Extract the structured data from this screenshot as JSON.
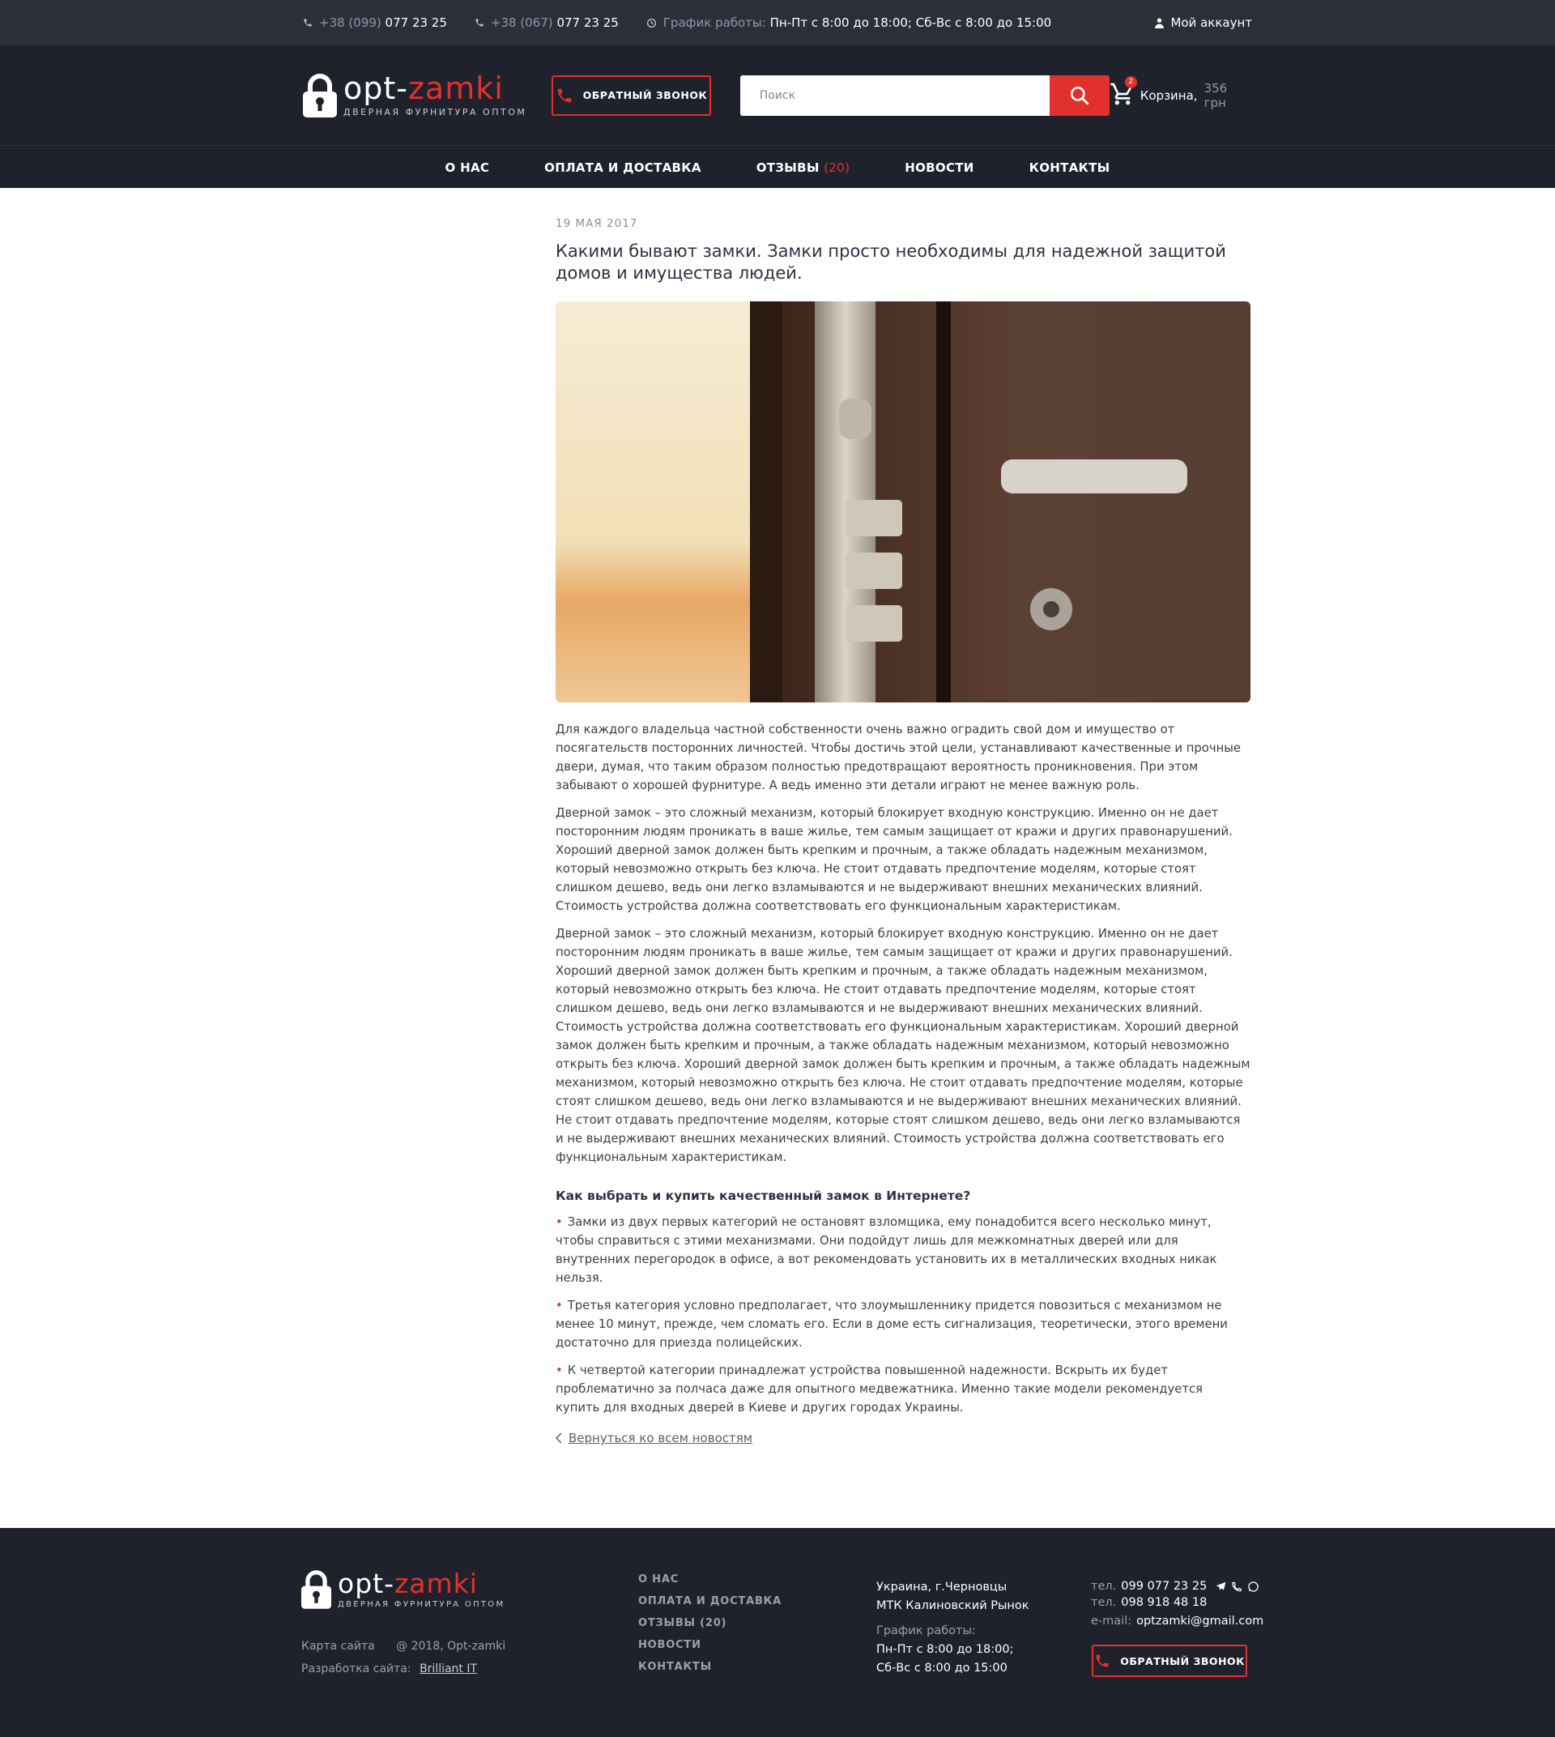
{
  "topbar": {
    "phone1_prefix": "+38 (099)",
    "phone1_number": "077 23 25",
    "phone2_prefix": "+38 (067)",
    "phone2_number": "077 23 25",
    "schedule_label": "График работы:",
    "schedule_value": "Пн-Пт с 8:00 до 18:00; Сб-Вс с  8:00 до 15:00",
    "account_label": "Мой аккаунт"
  },
  "header": {
    "logo_part1": "opt-",
    "logo_part2": "zamki",
    "logo_subtitle": "ДВЕРНАЯ ФУРНИТУРА ОПТОМ",
    "callback_label": "ОБРАТНЫЙ ЗВОНОК",
    "search_placeholder": "Поиск",
    "cart_count": "2",
    "cart_label": "Корзина,",
    "cart_sum": "356 грн"
  },
  "nav": {
    "items": [
      {
        "label": "О НАС",
        "count": ""
      },
      {
        "label": "ОПЛАТА И ДОСТАВКА",
        "count": ""
      },
      {
        "label": "ОТЗЫВЫ",
        "count": "(20)"
      },
      {
        "label": "НОВОСТИ",
        "count": ""
      },
      {
        "label": "КОНТАКТЫ",
        "count": ""
      }
    ]
  },
  "article": {
    "date": "19 МАЯ 2017",
    "title": "Какими бывают замки. Замки просто необходимы для надежной защитой домов и имущества людей.",
    "paragraphs": [
      "Для каждого владельца частной собственности очень важно оградить свой дом и имущество от посягательств посторонних личностей. Чтобы достичь этой цели, устанавливают качественные и прочные двери, думая, что таким образом полностью предотвращают вероятность проникновения. При этом забывают о хорошей фурнитуре. А ведь именно эти детали играют не менее важную роль.",
      "Дверной замок – это сложный механизм, который блокирует входную конструкцию. Именно он не дает посторонним людям проникать в ваше жилье, тем самым защищает от кражи и других правонарушений. Хороший дверной замок должен быть крепким и прочным, а также обладать надежным механизмом, который невозможно открыть без ключа. Не стоит отдавать предпочтение моделям, которые стоят слишком дешево, ведь они легко взламываются и не выдерживают внешних механических влияний. Стоимость устройства должна соответствовать его функциональным характеристикам.",
      "Дверной замок – это сложный механизм, который блокирует входную конструкцию. Именно он не дает посторонним людям проникать в ваше жилье, тем самым защищает от кражи и других правонарушений. Хороший дверной замок должен быть крепким и прочным, а также обладать надежным механизмом, который невозможно открыть без ключа. Не стоит отдавать предпочтение моделям, которые стоят слишком дешево, ведь они легко взламываются и не выдерживают внешних механических влияний. Стоимость устройства должна соответствовать его функциональным характеристикам. Хороший дверной замок должен быть крепким и прочным, а также обладать надежным механизмом, который невозможно открыть без ключа. Хороший дверной замок должен быть крепким и прочным, а также обладать надежным механизмом, который невозможно открыть без ключа. Не стоит отдавать предпочтение моделям, которые стоят слишком дешево, ведь они легко взламываются и не выдерживают внешних механических влияний. Не стоит отдавать предпочтение моделям, которые стоят слишком дешево, ведь они легко взламываются и не выдерживают внешних механических влияний. Стоимость устройства должна соответствовать его функциональным характеристикам."
    ],
    "subheading": "Как выбрать и купить качественный замок в Интернете?",
    "bullets": [
      "Замки из двух первых категорий не остановят взломщика, ему понадобится всего несколько минут, чтобы справиться с этими механизмами. Они подойдут лишь для межкомнатных дверей или для внутренних перегородок в офисе, а вот рекомендовать установить их в металлических входных никак нельзя.",
      "Третья категория условно предполагает, что злоумышленнику придется повозиться с механизмом не менее 10 минут, прежде, чем сломать его. Если в доме есть сигнализация, теоретически, этого времени достаточно для приезда полицейских.",
      "К четвертой категории принадлежат устройства повышенной надежности. Вскрыть их будет проблематично за полчаса даже для опытного медвежатника. Именно такие модели рекомендуется купить для входных дверей в Киеве и других городах Украины."
    ],
    "back_label": "Вернуться ко всем новостям"
  },
  "footer": {
    "sitemap_label": "Карта сайта",
    "copyright": "@ 2018, Opt-zamki",
    "dev_label": "Разработка сайта:",
    "dev_name": "Brilliant IT",
    "links": [
      "О НАС",
      "ОПЛАТА И ДОСТАВКА",
      "ОТЗЫВЫ (20)",
      "НОВОСТИ",
      "КОНТАКТЫ"
    ],
    "address_line1": "Украина, г.Черновцы",
    "address_line2": "МТК Калиновский Рынок",
    "schedule_label": "График работы:",
    "schedule_line1": "Пн-Пт с 8:00 до 18:00;",
    "schedule_line2": "Сб-Вс с  8:00 до 15:00",
    "tel_label": "тел.",
    "tel1": "099 077 23 25",
    "tel2": "098 918 48 18",
    "email_label": "e-mail:",
    "email": "optzamki@gmail.com",
    "callback_label": "ОБРАТНЫЙ ЗВОНОК"
  },
  "colors": {
    "accent": "#e2312c",
    "topbar_bg": "#2b2f3a",
    "header_bg": "#1f222c"
  },
  "icons": {
    "phone": "phone-icon",
    "clock": "clock-icon",
    "user": "user-icon",
    "lock_logo": "padlock-logo-icon",
    "search": "search-icon",
    "cart": "cart-icon",
    "back": "chevron-left-icon",
    "telegram": "telegram-icon",
    "viber": "viber-icon",
    "whatsapp": "whatsapp-icon"
  }
}
